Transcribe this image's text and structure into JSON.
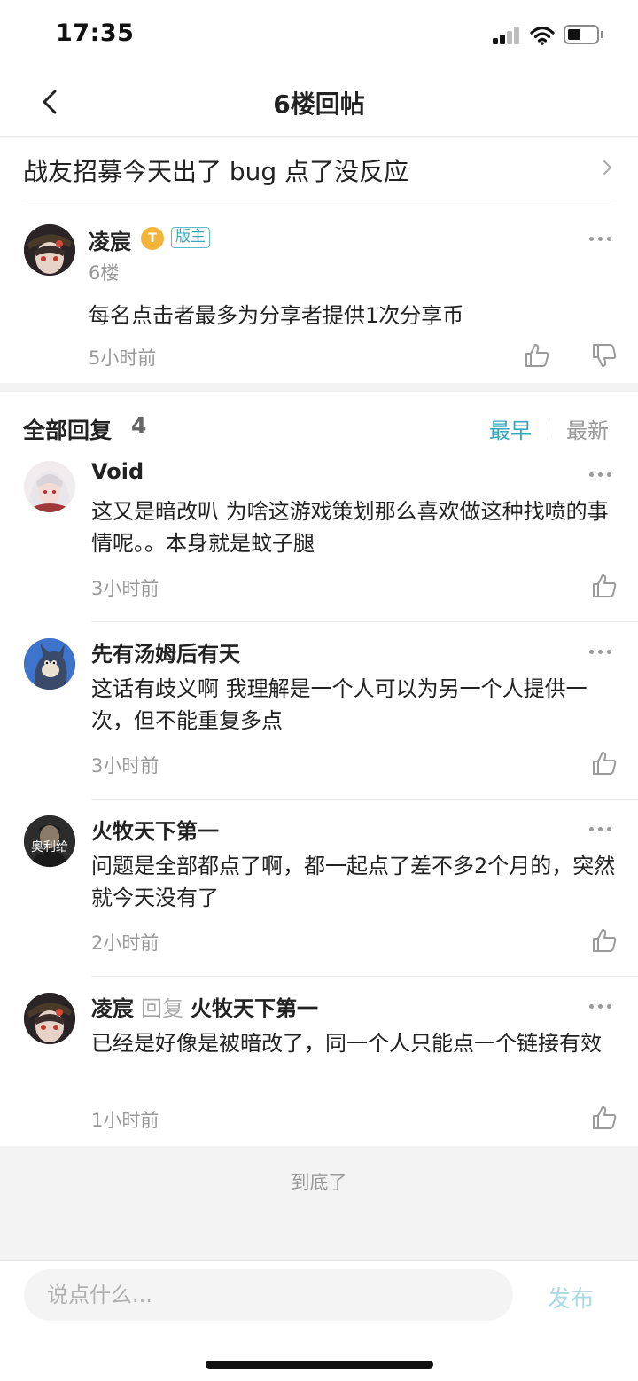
{
  "status": {
    "time": "17:35"
  },
  "nav": {
    "title": "6楼回帖"
  },
  "thread": {
    "title": "战友招募今天出了 bug 点了没反应"
  },
  "post": {
    "author": "凌宸",
    "level_badge": "T",
    "role_badge": "版主",
    "floor": "6楼",
    "content": "每名点击者最多为分享者提供1次分享币",
    "time": "5小时前"
  },
  "replies_header": {
    "label": "全部回复",
    "count": "4",
    "sort_early": "最早",
    "sort_new": "最新"
  },
  "replies": [
    {
      "author": "Void",
      "text": "这又是暗改叭 为啥这游戏策划那么喜欢做这种找喷的事情呢。。本身就是蚊子腿",
      "time": "3小时前"
    },
    {
      "author": "先有汤姆后有天",
      "text": "这话有歧义啊 我理解是一个人可以为另一个人提供一次，但不能重复多点",
      "time": "3小时前"
    },
    {
      "author": "火牧天下第一",
      "avatar_text": "奥利给",
      "text": "问题是全部都点了啊，都一起点了差不多2个月的，突然就今天没有了",
      "time": "2小时前"
    },
    {
      "author": "凌宸",
      "reply_word": "回复",
      "reply_to": "火牧天下第一",
      "text": "已经是好像是被暗改了，同一个人只能点一个链接有效",
      "time": "1小时前"
    }
  ],
  "footer": {
    "end_text": "到底了"
  },
  "input": {
    "placeholder": "说点什么...",
    "publish": "发布"
  },
  "colors": {
    "accent": "#3aa6b9",
    "publish_disabled": "#a8dbe3",
    "muted": "#999999"
  }
}
